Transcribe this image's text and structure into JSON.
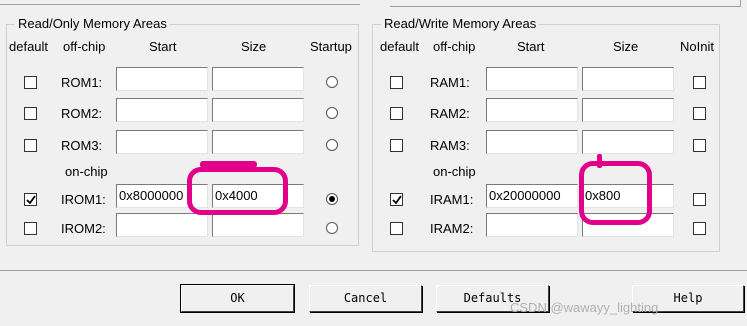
{
  "readonly": {
    "title": "Read/Only Memory Areas",
    "headers": {
      "default": "default",
      "offchip": "off-chip",
      "start": "Start",
      "size": "Size",
      "extra": "Startup"
    },
    "section_onchip": "on-chip",
    "rows": [
      {
        "label": "ROM1:",
        "default": false,
        "start": "",
        "size": "",
        "selected": false
      },
      {
        "label": "ROM2:",
        "default": false,
        "start": "",
        "size": "",
        "selected": false
      },
      {
        "label": "ROM3:",
        "default": false,
        "start": "",
        "size": "",
        "selected": false
      },
      {
        "label": "IROM1:",
        "default": true,
        "start": "0x8000000",
        "size": "0x4000",
        "selected": true
      },
      {
        "label": "IROM2:",
        "default": false,
        "start": "",
        "size": "",
        "selected": false
      }
    ]
  },
  "readwrite": {
    "title": "Read/Write Memory Areas",
    "headers": {
      "default": "default",
      "offchip": "off-chip",
      "start": "Start",
      "size": "Size",
      "extra": "NoInit"
    },
    "section_onchip": "on-chip",
    "rows": [
      {
        "label": "RAM1:",
        "default": false,
        "start": "",
        "size": "",
        "noinit": false
      },
      {
        "label": "RAM2:",
        "default": false,
        "start": "",
        "size": "",
        "noinit": false
      },
      {
        "label": "RAM3:",
        "default": false,
        "start": "",
        "size": "",
        "noinit": false
      },
      {
        "label": "IRAM1:",
        "default": true,
        "start": "0x20000000",
        "size": "0x800",
        "noinit": false
      },
      {
        "label": "IRAM2:",
        "default": false,
        "start": "",
        "size": "",
        "noinit": false
      }
    ]
  },
  "buttons": {
    "ok": "OK",
    "cancel": "Cancel",
    "defaults": "Defaults",
    "help": "Help"
  },
  "watermark": "CSDN @wawayy_lighting",
  "colors": {
    "highlight": "#e1008a",
    "background": "#f0f0f0"
  }
}
